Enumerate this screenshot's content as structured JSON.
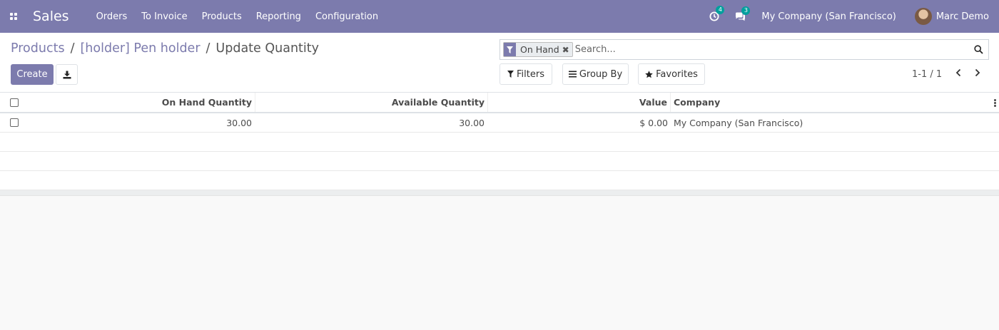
{
  "navbar": {
    "app_name": "Sales",
    "menu": [
      "Orders",
      "To Invoice",
      "Products",
      "Reporting",
      "Configuration"
    ],
    "activity_count": "4",
    "message_count": "3",
    "company": "My Company (San Francisco)",
    "user": "Marc Demo",
    "bar_color": "#7c7bad"
  },
  "breadcrumb": {
    "items": [
      "Products",
      "[holder] Pen holder"
    ],
    "separator": "/",
    "current": "Update Quantity"
  },
  "buttons": {
    "create": "Create",
    "download_icon": "download-icon"
  },
  "search": {
    "facet_label": "On Hand",
    "facet_remove": "✖",
    "placeholder": "Search...",
    "filters": "Filters",
    "group_by": "Group By",
    "favorites": "Favorites"
  },
  "pager": {
    "value": "1-1 / 1"
  },
  "table": {
    "columns": [
      "On Hand Quantity",
      "Available Quantity",
      "Value",
      "Company"
    ],
    "rows": [
      {
        "on_hand": "30.00",
        "available": "30.00",
        "value": "$ 0.00",
        "company": "My Company (San Francisco)"
      }
    ]
  }
}
